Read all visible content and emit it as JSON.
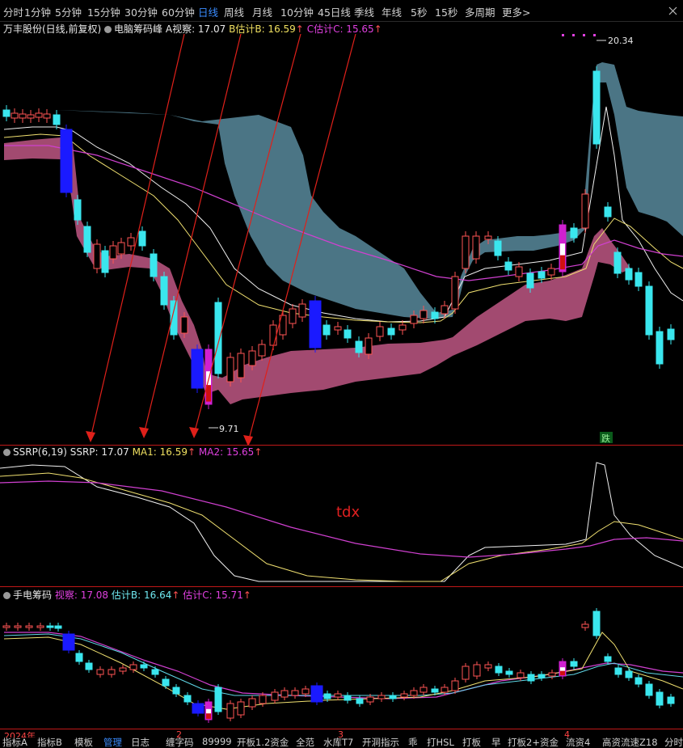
{
  "period_bar": {
    "items": [
      "分时",
      "1分钟",
      "5分钟",
      "15分钟",
      "30分钟",
      "60分钟",
      "日线",
      "周线",
      "月线",
      "10分钟",
      "45日线",
      "季线",
      "年线",
      "5秒",
      "15秒",
      "多周期",
      "更多>"
    ],
    "active": "日线"
  },
  "main_panel": {
    "stock_title": "万丰股份(日线,前复权)",
    "indicator_name": "电脑筹码峰",
    "a_label": "A视察: 17.07",
    "b_label": "B估计B: 16.59",
    "b_arrow": "↑",
    "c_label": "C估计C: 15.65",
    "c_arrow": "↑",
    "high_price": "20.34",
    "low_price": "9.71",
    "tag_die": "跌"
  },
  "ssrp_panel": {
    "name": "SSRP(6,19)",
    "ssrp_label": "SSRP: 17.07",
    "ma1_label": "MA1: 16.59",
    "ma1_arrow": "↑",
    "ma2_label": "MA2: 15.65",
    "ma2_arrow": "↑",
    "watermark_text": "tdx"
  },
  "chip_panel": {
    "name": "手电筹码",
    "view_label": "视察: 17.08",
    "b_label": "估计B: 16.64",
    "b_arrow": "↑",
    "c_label": "估计C: 15.71",
    "c_arrow": "↑"
  },
  "axis": {
    "year_label": "2024年",
    "month_2": "2",
    "month_3": "3",
    "month_4": "4"
  },
  "bottom_tabs": [
    "指标A",
    "指标B",
    "模板",
    "管理",
    "日志",
    "缠字码",
    "89999",
    "开板1.2资金",
    "全范",
    "水库T7",
    "开洞指示",
    "乖",
    "打HSL",
    "打板",
    "早",
    "打板2+资金",
    "流资4",
    "高资流速Z18",
    "分时"
  ],
  "colors": {
    "up_candle": "#ff5555",
    "down_candle": "#3ae6ee",
    "cloud_band": "#4f7b8c",
    "chip_band": "#b0507a",
    "line_white": "#f0f0f0",
    "line_yellow": "#f0e070",
    "line_magenta": "#d040d0",
    "panel_border": "#c01818",
    "arrow_red": "#e0201a",
    "active_tab": "#3a8cff"
  }
}
